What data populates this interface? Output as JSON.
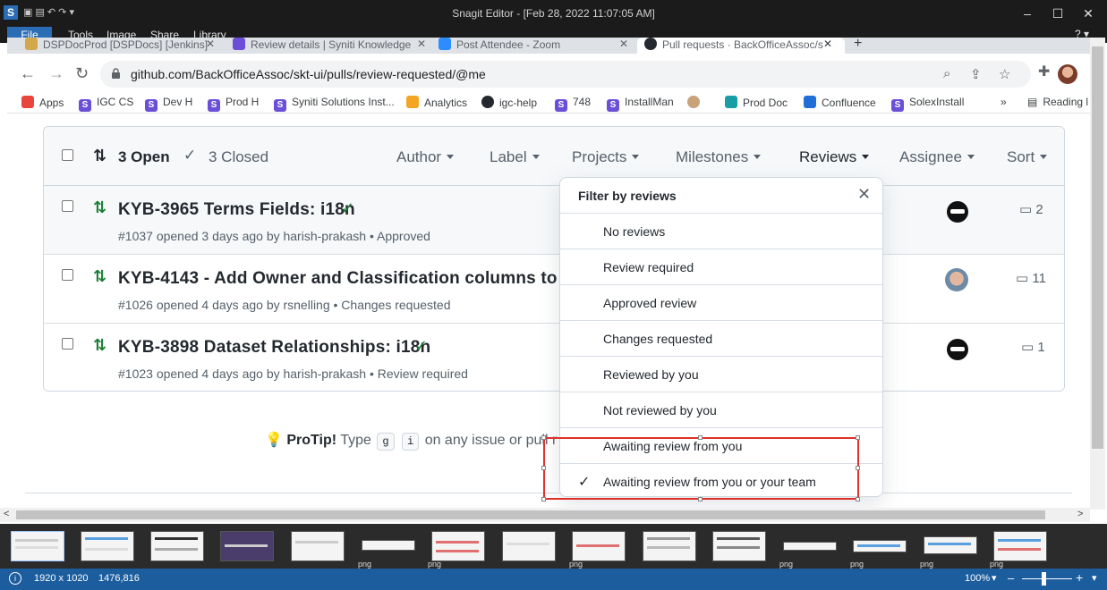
{
  "snagit": {
    "title": "Snagit Editor - [Feb 28, 2022 11:07:05 AM]",
    "menu": {
      "file": "File",
      "items": [
        "Tools",
        "Image",
        "Share",
        "Library"
      ]
    },
    "help_icon": "help-icon",
    "status": {
      "dimensions": "1920 x 1020",
      "cursor": "1476,816",
      "zoom": "100%"
    },
    "tray_labels": [
      "png",
      "png",
      "png",
      "png",
      "png",
      "png",
      "png"
    ]
  },
  "browser": {
    "tabs": [
      {
        "label": "DSPDocProd [DSPDocs] [Jenkins]",
        "color": "#d3a84c"
      },
      {
        "label": "Review details | Syniti Knowledge",
        "color": "#6b4fd8"
      },
      {
        "label": "Post Attendee - Zoom",
        "color": "#2d8cff"
      },
      {
        "label": "Pull requests · BackOfficeAssoc/s",
        "color": "#24292f"
      }
    ],
    "url": "github.com/BackOfficeAssoc/skt-ui/pulls/review-requested/@me",
    "bookmarks": [
      {
        "label": "Apps",
        "color": "#e8453c",
        "glyph": ""
      },
      {
        "label": "IGC CS",
        "color": "#6b4fd8",
        "glyph": "S"
      },
      {
        "label": "Dev H",
        "color": "#6b4fd8",
        "glyph": "S"
      },
      {
        "label": "Prod H",
        "color": "#6b4fd8",
        "glyph": "S"
      },
      {
        "label": "Syniti Solutions Inst...",
        "color": "#6b4fd8",
        "glyph": "S"
      },
      {
        "label": "Analytics",
        "color": "#f4a622",
        "glyph": ""
      },
      {
        "label": "igc-help",
        "color": "#24292f",
        "glyph": ""
      },
      {
        "label": "748",
        "color": "#6b4fd8",
        "glyph": "S"
      },
      {
        "label": "InstallMan",
        "color": "#6b4fd8",
        "glyph": "S"
      },
      {
        "label": "",
        "color": "#c9a27a",
        "glyph": ""
      },
      {
        "label": "Prod Doc",
        "color": "#1a9ea6",
        "glyph": ""
      },
      {
        "label": "Confluence",
        "color": "#1f6fd6",
        "glyph": ""
      },
      {
        "label": "SolexInstall",
        "color": "#6b4fd8",
        "glyph": "S"
      }
    ],
    "bookmarks_more": "»",
    "reading_list": "Reading l"
  },
  "github": {
    "open_count": "3 Open",
    "closed_count": "3 Closed",
    "filters": [
      "Author",
      "Label",
      "Projects",
      "Milestones",
      "Reviews",
      "Assignee",
      "Sort"
    ],
    "prs": [
      {
        "title": "KYB-3965 Terms Fields: i18n",
        "check": true,
        "meta": "#1037 opened 3 days ago by harish-prakash • Approved",
        "comments": "2",
        "avatar": "bot"
      },
      {
        "title": "KYB-4143 - Add Owner and Classification columns to Dat",
        "check": false,
        "meta": "#1026 opened 4 days ago by rsnelling • Changes requested",
        "comments": "11",
        "avatar": "face"
      },
      {
        "title": "KYB-3898 Dataset Relationships: i18n",
        "check": true,
        "meta": "#1023 opened 4 days ago by harish-prakash • Review required",
        "comments": "1",
        "avatar": "bot"
      }
    ],
    "protip": {
      "label": "ProTip!",
      "text_before": "Type",
      "key1": "g",
      "key2": "i",
      "text_after": "on any issue or pull r"
    },
    "review_filter": {
      "title": "Filter by reviews",
      "options": [
        {
          "label": "No reviews",
          "selected": false
        },
        {
          "label": "Review required",
          "selected": false
        },
        {
          "label": "Approved review",
          "selected": false
        },
        {
          "label": "Changes requested",
          "selected": false
        },
        {
          "label": "Reviewed by you",
          "selected": false
        },
        {
          "label": "Not reviewed by you",
          "selected": false
        },
        {
          "label": "Awaiting review from you",
          "selected": false
        },
        {
          "label": "Awaiting review from you or your team",
          "selected": true
        }
      ]
    }
  }
}
